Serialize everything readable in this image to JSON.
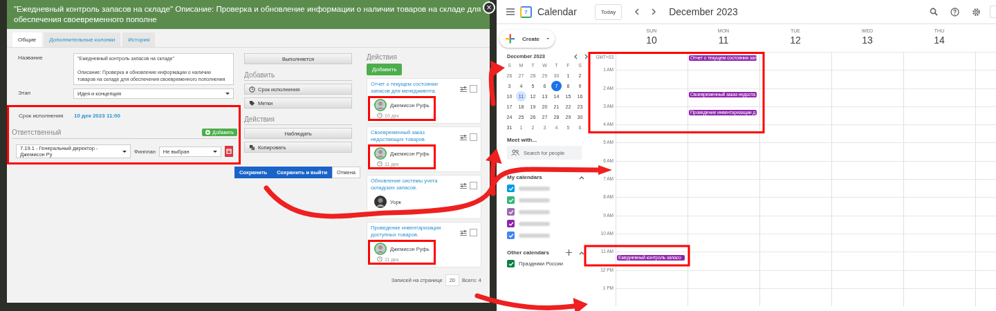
{
  "task_dialog": {
    "title": "\"Ежедневный контроль запасов на складе\" Описание: Проверка и обновление информации о наличии товаров на складе для обеспечения своевременного пополне",
    "close": "×",
    "tabs": [
      {
        "label": "Общие",
        "selected": true
      },
      {
        "label": "Дополнительные колонки",
        "selected": false
      },
      {
        "label": "История",
        "selected": false
      }
    ],
    "form": {
      "name_label": "Название",
      "name_value": "\"Ежедневный контроль запасов на складе\"\n\nОписание: Проверка и обновление информации о наличии товаров на складе для обеспечения своевременного пополнения",
      "stage_label": "Этап",
      "stage_value": "Идея и концепция",
      "deadline_label": "Срок исполнения",
      "deadline_value": "10 дек 2023 11:00",
      "responsible_heading": "Ответственный",
      "add_button": "Добавить",
      "responsible_value": "7.19.1 - Генеральный директор - Джемисон Ру",
      "finplan_label": "Финплан",
      "finplan_value": "Не выбран"
    },
    "status_button": "Выполняется",
    "add_section": {
      "heading": "Добавить",
      "buttons": [
        {
          "label": "Срок исполнения",
          "kind": "clock"
        },
        {
          "label": "Метки",
          "kind": "tag"
        }
      ]
    },
    "actions_section": {
      "heading": "Действия",
      "buttons": [
        {
          "label": "Наблюдать",
          "kind": "plain"
        },
        {
          "label": "Копировать",
          "kind": "copy"
        }
      ]
    },
    "footer_buttons": [
      {
        "label": "Сохранить",
        "kind": "primary"
      },
      {
        "label": "Сохранить и выйти",
        "kind": "primary"
      },
      {
        "label": "Отмена",
        "kind": "default"
      }
    ],
    "actions_panel": {
      "heading": "Действия",
      "add_button": "Добавить",
      "cards": [
        {
          "title": "Отчет о текущем состоянии запасов для менеджмента.",
          "assignee": "Джемисон Руфь",
          "date": "10 дек",
          "kind": "default",
          "checked": false
        },
        {
          "title": "Своевременный заказ недостающих товаров.",
          "assignee": "Джемисон Руфь",
          "date": "11 дек",
          "kind": "default",
          "checked": false
        },
        {
          "title": "Обновление системы учета складских запасов.",
          "assignee": "Уорк",
          "kind": "photo",
          "checked": false
        },
        {
          "title": "Проведение инвентаризации доступных товаров.",
          "assignee": "Джемисон Руфь",
          "date": "11 дек",
          "kind": "default",
          "checked": false
        }
      ],
      "page_size_label": "Записей на странице",
      "page_size": "20",
      "total": "Всего: 4"
    }
  },
  "calendar": {
    "logo_day": "7",
    "app_name": "Calendar",
    "today_button": "Today",
    "period": "December 2023",
    "create_button": "Create",
    "mini_month": {
      "title": "December 2023",
      "weekdays": [
        "S",
        "M",
        "T",
        "W",
        "T",
        "F",
        "S"
      ],
      "weeks": [
        [
          {
            "day": "26",
            "kind": "other"
          },
          {
            "day": "27",
            "kind": "other"
          },
          {
            "day": "28",
            "kind": "other"
          },
          {
            "day": "29",
            "kind": "other"
          },
          {
            "day": "30",
            "kind": "other"
          },
          {
            "day": "1",
            "kind": "day"
          },
          {
            "day": "2",
            "kind": "day"
          }
        ],
        [
          {
            "day": "3",
            "kind": "day"
          },
          {
            "day": "4",
            "kind": "day"
          },
          {
            "day": "5",
            "kind": "day"
          },
          {
            "day": "6",
            "kind": "day"
          },
          {
            "day": "7",
            "kind": "today"
          },
          {
            "day": "8",
            "kind": "day"
          },
          {
            "day": "9",
            "kind": "day"
          }
        ],
        [
          {
            "day": "10",
            "kind": "day"
          },
          {
            "day": "11",
            "kind": "viewed"
          },
          {
            "day": "12",
            "kind": "day"
          },
          {
            "day": "13",
            "kind": "day"
          },
          {
            "day": "14",
            "kind": "day"
          },
          {
            "day": "15",
            "kind": "day"
          },
          {
            "day": "16",
            "kind": "day"
          }
        ],
        [
          {
            "day": "17",
            "kind": "day"
          },
          {
            "day": "18",
            "kind": "day"
          },
          {
            "day": "19",
            "kind": "day"
          },
          {
            "day": "20",
            "kind": "day"
          },
          {
            "day": "21",
            "kind": "day"
          },
          {
            "day": "22",
            "kind": "day"
          },
          {
            "day": "23",
            "kind": "day"
          }
        ],
        [
          {
            "day": "24",
            "kind": "day"
          },
          {
            "day": "25",
            "kind": "day"
          },
          {
            "day": "26",
            "kind": "day"
          },
          {
            "day": "27",
            "kind": "day"
          },
          {
            "day": "28",
            "kind": "day"
          },
          {
            "day": "29",
            "kind": "day"
          },
          {
            "day": "30",
            "kind": "day"
          }
        ],
        [
          {
            "day": "31",
            "kind": "day"
          },
          {
            "day": "1",
            "kind": "other"
          },
          {
            "day": "2",
            "kind": "other"
          },
          {
            "day": "3",
            "kind": "other"
          },
          {
            "day": "4",
            "kind": "other"
          },
          {
            "day": "5",
            "kind": "other"
          },
          {
            "day": "6",
            "kind": "other"
          }
        ]
      ]
    },
    "meet_heading": "Meet with...",
    "people_search": {
      "placeholder": "Search for people"
    },
    "my_calendars": {
      "heading": "My calendars",
      "items": [
        {
          "color": "#039be5",
          "checked": true
        },
        {
          "color": "#33b679",
          "checked": true
        },
        {
          "color": "#9e69af",
          "checked": true
        },
        {
          "color": "#8e24aa",
          "checked": true
        },
        {
          "color": "#4285f4",
          "checked": true
        }
      ]
    },
    "other_calendars": {
      "heading": "Other calendars",
      "items": [
        {
          "label": "Праздники России",
          "color": "#0b8043",
          "checked": true
        }
      ]
    },
    "days": [
      {
        "weekday": "SUN",
        "date": "10"
      },
      {
        "weekday": "MON",
        "date": "11"
      },
      {
        "weekday": "TUE",
        "date": "12"
      },
      {
        "weekday": "WED",
        "date": "13"
      },
      {
        "weekday": "THU",
        "date": "14"
      }
    ],
    "time_rows": [
      {
        "label": "GMT+03",
        "mon": "Отчет о текущем состоянии зап"
      },
      {
        "label": "1 AM"
      },
      {
        "label": "2 AM",
        "mon": "Своевременный заказ недоста"
      },
      {
        "label": "3 AM",
        "mon": "Проведение инвентаризации д"
      },
      {
        "label": "4 AM"
      },
      {
        "label": "5 AM"
      },
      {
        "label": "6 AM"
      },
      {
        "label": "7 AM"
      },
      {
        "label": "8 AM"
      },
      {
        "label": "9 AM"
      },
      {
        "label": "10 AM"
      },
      {
        "label": "11 AM",
        "sun": "Ежедневный контроль запасо"
      },
      {
        "label": "12 PM"
      },
      {
        "label": "1 PM"
      }
    ]
  }
}
